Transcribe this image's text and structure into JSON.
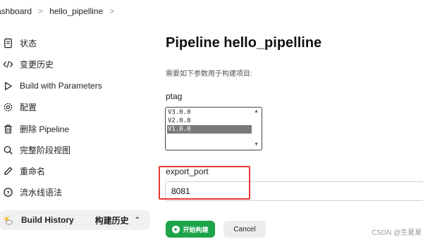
{
  "breadcrumb": {
    "items": [
      "ashboard",
      "hello_pipelline"
    ],
    "separator": ">"
  },
  "sidebar": {
    "items": [
      {
        "label": "状态",
        "icon": "document-icon"
      },
      {
        "label": "变更历史",
        "icon": "code-icon"
      },
      {
        "label": "Build with Parameters",
        "icon": "play-icon"
      },
      {
        "label": "配置",
        "icon": "gear-icon"
      },
      {
        "label": "删除 Pipeline",
        "icon": "trash-icon"
      },
      {
        "label": "完整阶段视图",
        "icon": "search-icon"
      },
      {
        "label": "重命名",
        "icon": "pencil-icon"
      },
      {
        "label": "流水线语法",
        "icon": "help-icon"
      }
    ],
    "build_history": {
      "label": "Build History",
      "right_label": "构建历史",
      "icon": "weather-icon"
    }
  },
  "main": {
    "title": "Pipeline hello_pipelline",
    "subtitle": "需要如下参数用于构建项目:",
    "params": {
      "ptag": {
        "label": "ptag",
        "options": [
          "V3.0.0",
          "V2.0.0",
          "V1.0.0"
        ],
        "selected": "V1.0.0"
      },
      "export_port": {
        "label": "export_port",
        "value": "8081"
      }
    },
    "build_button": "开始构建",
    "cancel_button": "Cancel"
  },
  "colors": {
    "build_button": "#1ea34a",
    "highlight": "#e53935",
    "selected_option": "#7a7a7a"
  },
  "watermark": "CSDN @生夏夏"
}
